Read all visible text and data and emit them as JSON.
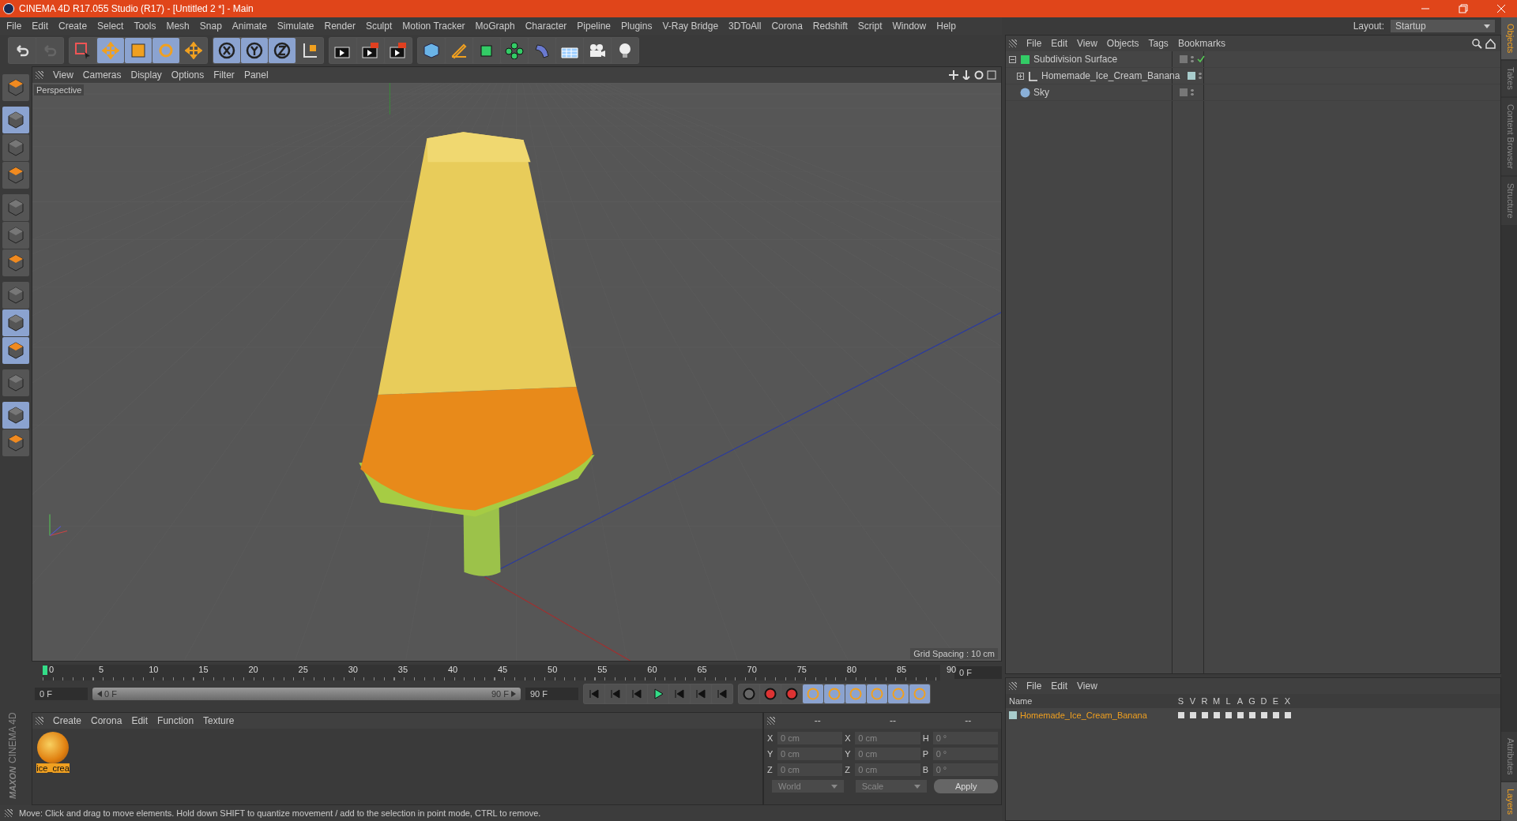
{
  "window": {
    "title": "CINEMA 4D R17.055 Studio (R17) - [Untitled 2 *] - Main"
  },
  "menu": [
    "File",
    "Edit",
    "Create",
    "Select",
    "Tools",
    "Mesh",
    "Snap",
    "Animate",
    "Simulate",
    "Render",
    "Sculpt",
    "Motion Tracker",
    "MoGraph",
    "Character",
    "Pipeline",
    "Plugins",
    "V-Ray Bridge",
    "3DToAll",
    "Corona",
    "Redshift",
    "Script",
    "Window",
    "Help"
  ],
  "layout": {
    "label": "Layout:",
    "value": "Startup"
  },
  "viewport": {
    "menu": [
      "View",
      "Cameras",
      "Display",
      "Options",
      "Filter",
      "Panel"
    ],
    "camera": "Perspective",
    "grid_spacing": "Grid Spacing : 10 cm"
  },
  "timeline": {
    "ticks": [
      "0",
      "5",
      "10",
      "15",
      "20",
      "25",
      "30",
      "35",
      "40",
      "45",
      "50",
      "55",
      "60",
      "65",
      "70",
      "75",
      "80",
      "85",
      "90"
    ],
    "level": 0,
    "current": "0 F",
    "start": "0 F",
    "range": {
      "start": "0 F",
      "end": "90 F",
      "level": 1
    },
    "end": "90 F"
  },
  "materials": {
    "menu": [
      "Create",
      "Corona",
      "Edit",
      "Function",
      "Texture"
    ],
    "items": [
      {
        "name": "ice_crea",
        "selected": true
      }
    ]
  },
  "logo": {
    "brand": "MAXON",
    "product": "CINEMA 4D"
  },
  "coordinates": {
    "headers": [
      "--",
      "--",
      "--"
    ],
    "rows": [
      {
        "cells": [
          {
            "axis": "X",
            "value": "0 cm"
          },
          {
            "axis": "X",
            "value": "0 cm"
          },
          {
            "axis": "H",
            "value": "0 °"
          }
        ]
      },
      {
        "cells": [
          {
            "axis": "Y",
            "value": "0 cm"
          },
          {
            "axis": "Y",
            "value": "0 cm"
          },
          {
            "axis": "P",
            "value": "0 °"
          }
        ]
      },
      {
        "cells": [
          {
            "axis": "Z",
            "value": "0 cm"
          },
          {
            "axis": "Z",
            "value": "0 cm"
          },
          {
            "axis": "B",
            "value": "0 °"
          }
        ]
      }
    ],
    "dropdowns": [
      "World",
      "Scale"
    ],
    "apply": "Apply"
  },
  "status_bar": "Move: Click and drag to move elements. Hold down SHIFT to quantize movement / add to the selection in point mode, CTRL to remove.",
  "objects": {
    "menu": [
      "File",
      "Edit",
      "View",
      "Objects",
      "Tags",
      "Bookmarks"
    ],
    "tree": [
      {
        "name": "Subdivision Surface",
        "kind": "subdivision",
        "expanded": true,
        "children": [
          {
            "name": "Homemade_Ice_Cream_Banana",
            "kind": "null",
            "expanded": false,
            "color": "#a8cccc"
          }
        ]
      },
      {
        "name": "Sky",
        "kind": "sky"
      }
    ]
  },
  "side_tabs": [
    {
      "label": "Objects",
      "selected": true
    },
    {
      "label": "Takes",
      "selected": false
    },
    {
      "label": "Content Browser",
      "selected": false
    },
    {
      "label": "Structure",
      "selected": false
    }
  ],
  "layers": {
    "menu": [
      "File",
      "Edit",
      "View"
    ],
    "columns": [
      "Name",
      "S",
      "V",
      "R",
      "M",
      "L",
      "A",
      "G",
      "D",
      "E",
      "X"
    ],
    "rows": [
      {
        "name": "Homemade_Ice_Cream_Banana",
        "color": "#a8cccc"
      }
    ]
  },
  "bottom_tabs": [
    {
      "label": "Attributes",
      "selected": false
    },
    {
      "label": "Layers",
      "selected": true
    }
  ]
}
